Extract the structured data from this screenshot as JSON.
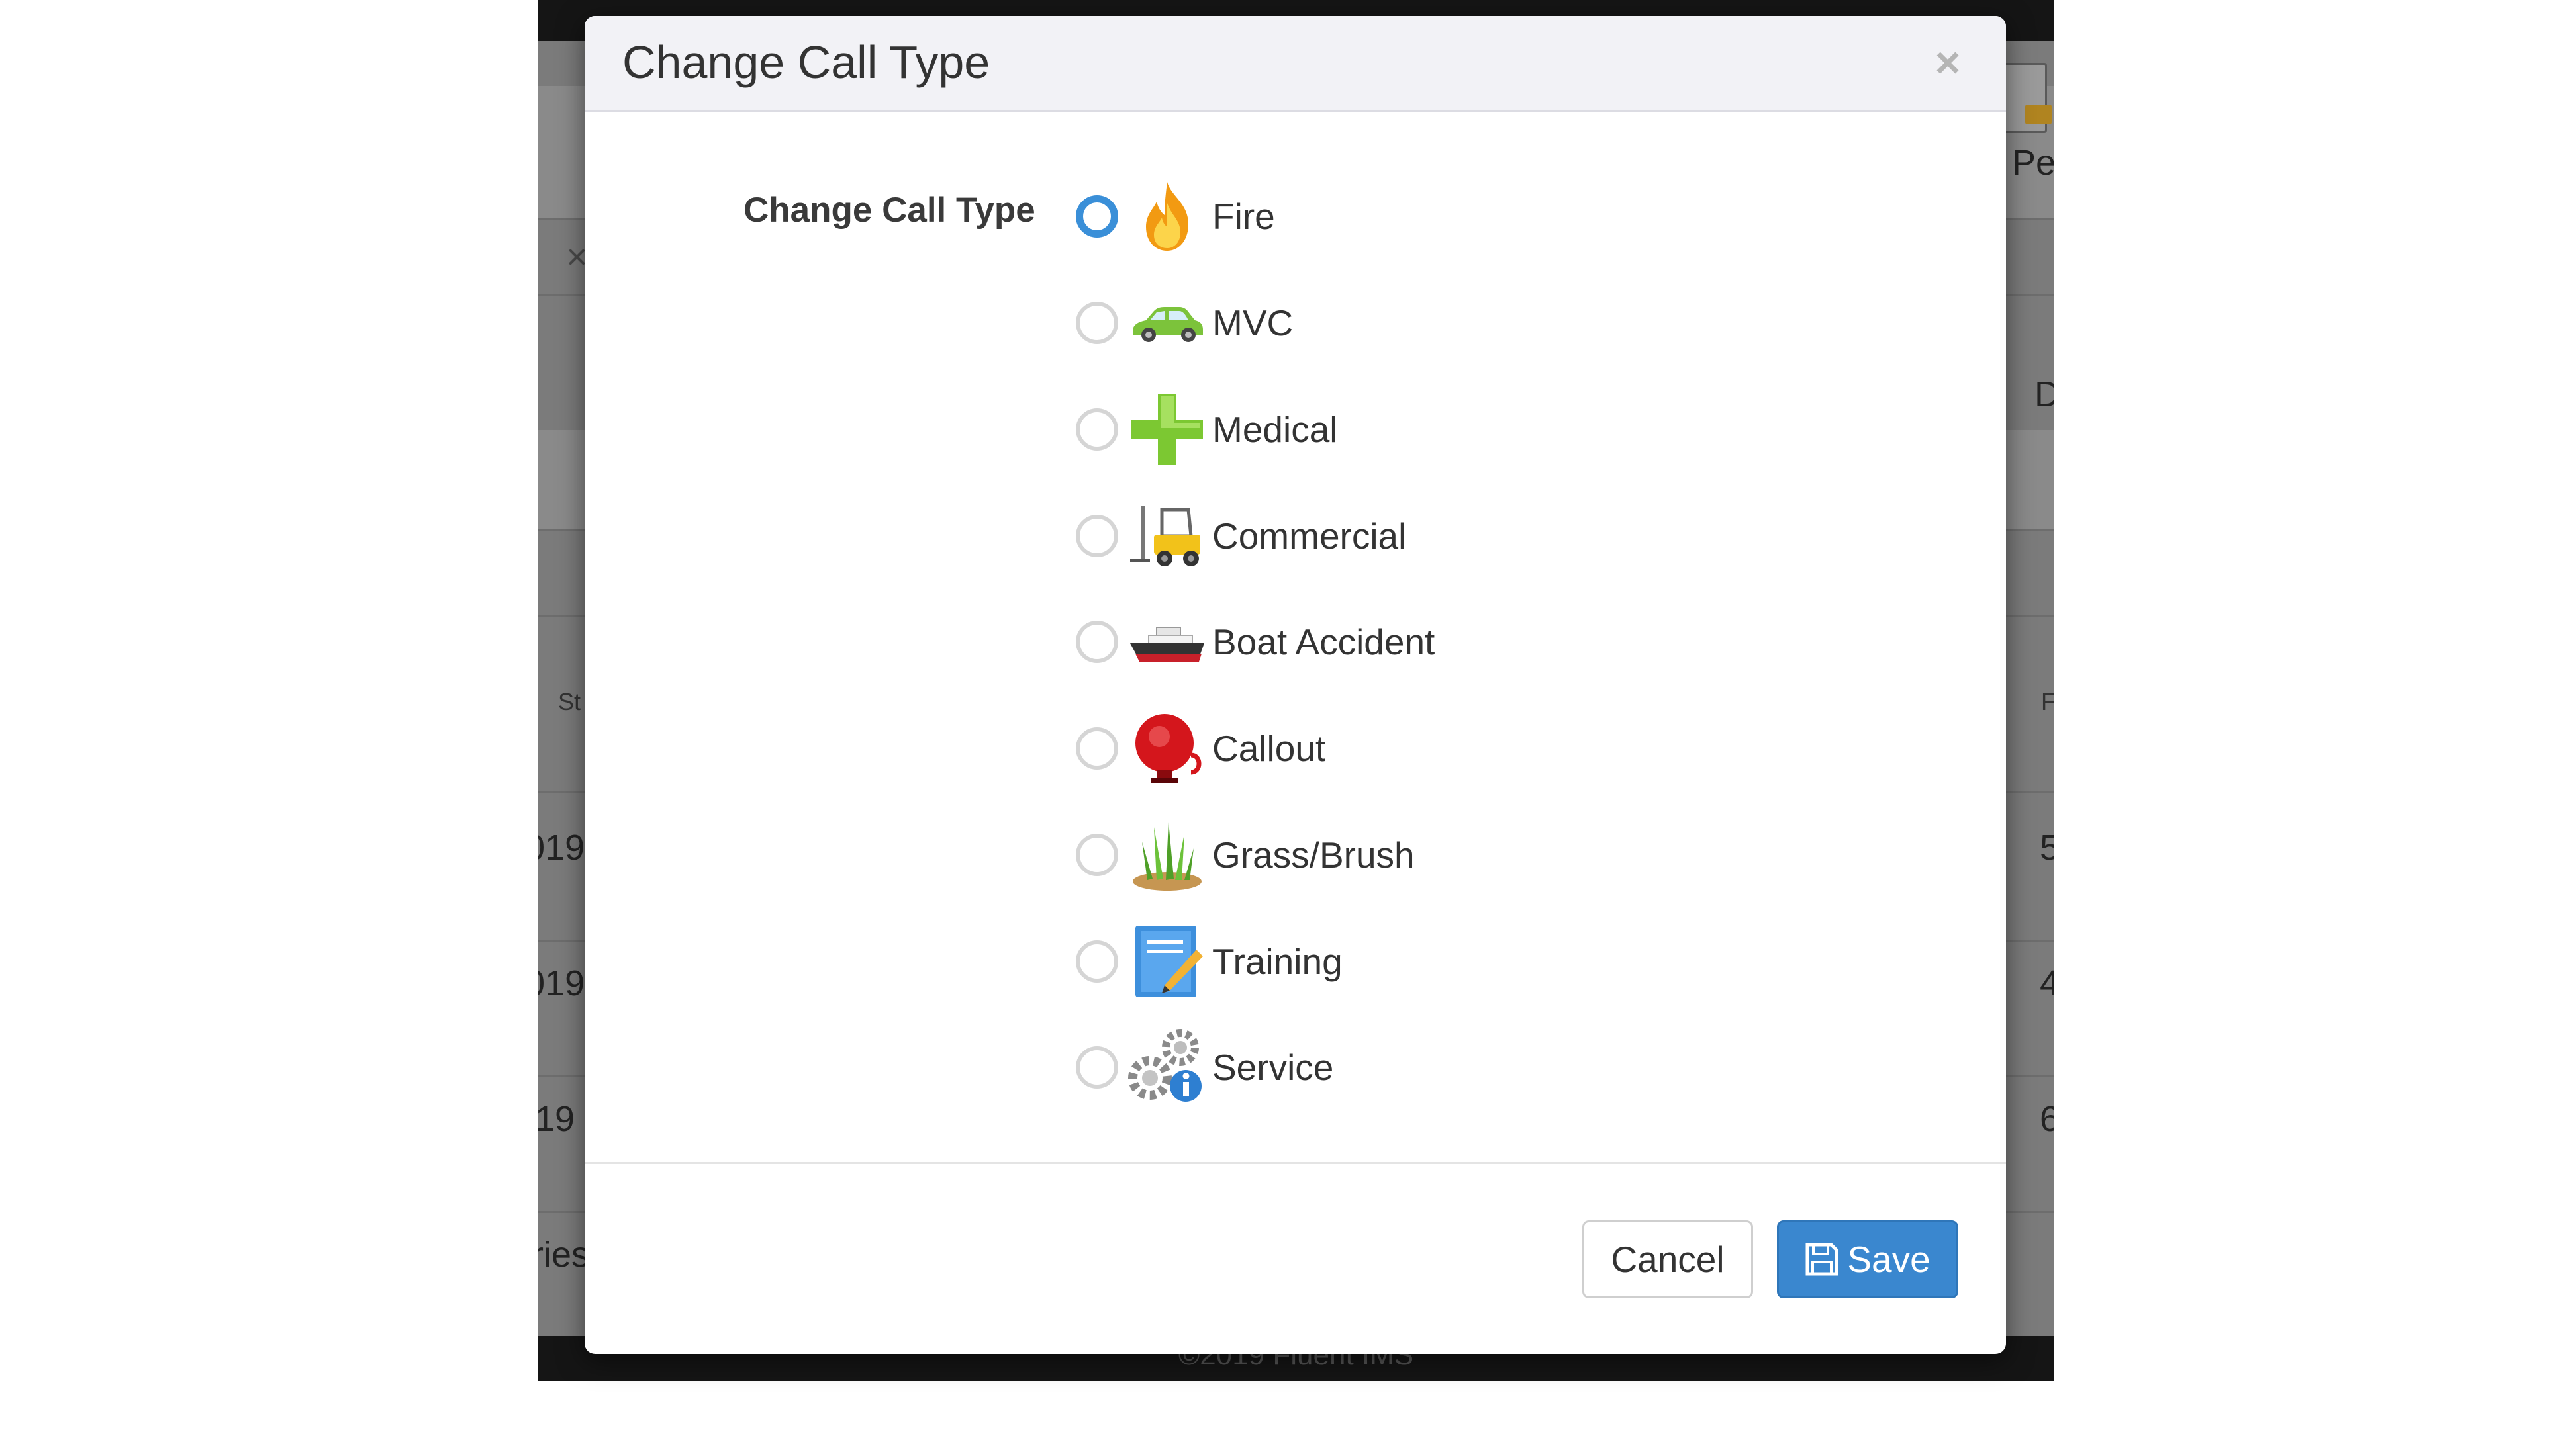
{
  "background_app": {
    "fragments": {
      "pe": "Pe",
      "d": "D",
      "st": "St",
      "f": "F",
      "row1_left": "019",
      "row1_right": "5",
      "row2_left": "019",
      "row2_right": "4",
      "row3_left": "19",
      "row3_right": "6",
      "entries": "ries",
      "footer": "©2019 Fluent IMS"
    }
  },
  "modal": {
    "title": "Change Call Type",
    "close_label": "×",
    "form_label": "Change Call Type",
    "selected": "Fire",
    "options": [
      {
        "label": "Fire",
        "icon": "fire-icon",
        "checked": true
      },
      {
        "label": "MVC",
        "icon": "car-icon",
        "checked": false
      },
      {
        "label": "Medical",
        "icon": "medical-cross-icon",
        "checked": false
      },
      {
        "label": "Commercial",
        "icon": "forklift-icon",
        "checked": false
      },
      {
        "label": "Boat Accident",
        "icon": "boat-icon",
        "checked": false
      },
      {
        "label": "Callout",
        "icon": "alarm-bell-icon",
        "checked": false
      },
      {
        "label": "Grass/Brush",
        "icon": "grass-icon",
        "checked": false
      },
      {
        "label": "Training",
        "icon": "notebook-pencil-icon",
        "checked": false
      },
      {
        "label": "Service",
        "icon": "gears-info-icon",
        "checked": false
      }
    ],
    "cancel_label": "Cancel",
    "save_label": "Save",
    "colors": {
      "primary": "#3a87cf",
      "radio_checked": "#3a8fd8",
      "header_bg": "#f2f2f6"
    }
  }
}
